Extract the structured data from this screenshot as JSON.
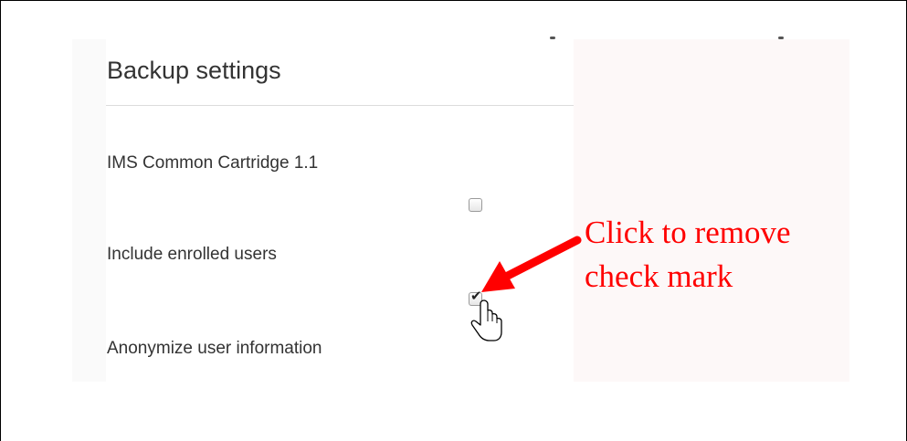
{
  "backup": {
    "title": "Backup settings",
    "settings": [
      {
        "label": "IMS Common Cartridge 1.1"
      },
      {
        "label": "Include enrolled users"
      },
      {
        "label": "Anonymize user information"
      }
    ],
    "checkbox_include_enrolled_users": {
      "checked": false
    },
    "checkbox_anonymize_user_information": {
      "checked": true
    }
  },
  "annotation": {
    "line1": "Click to remove",
    "line2": "check mark",
    "color": "#ff0000"
  },
  "icons": {
    "arrow": "red-arrow-icon",
    "cursor": "hand-pointer-icon",
    "check": "✔"
  }
}
